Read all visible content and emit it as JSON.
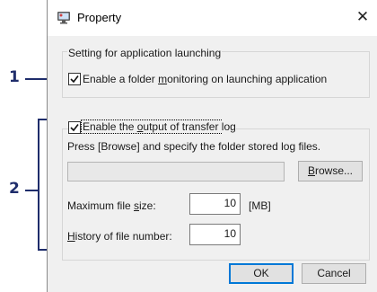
{
  "callouts": {
    "one": "1",
    "two": "2"
  },
  "dialog": {
    "title": "Property",
    "close_icon": "close-icon",
    "app_icon": "property-app-icon"
  },
  "launch_group": {
    "label": "Setting for application launching",
    "monitor_checkbox": {
      "checked": true,
      "label_pre": "Enable a folder ",
      "label_ul": "m",
      "label_post": "onitoring on launching application"
    }
  },
  "log_group": {
    "output_checkbox": {
      "checked": true,
      "label_pre": "Enable the ",
      "label_ul": "o",
      "label_post": "utput of transfer log"
    },
    "instruction": "Press [Browse] and specify the folder stored log files.",
    "folder_path": "",
    "browse": {
      "label_ul": "B",
      "label_post": "rowse..."
    },
    "max_size": {
      "label_pre": "Maximum file ",
      "label_ul": "s",
      "label_post": "ize:",
      "value": "10",
      "unit": "[MB]"
    },
    "history": {
      "label_ul": "H",
      "label_post": "istory of file number:",
      "value": "10"
    }
  },
  "buttons": {
    "ok": "OK",
    "cancel": "Cancel"
  }
}
